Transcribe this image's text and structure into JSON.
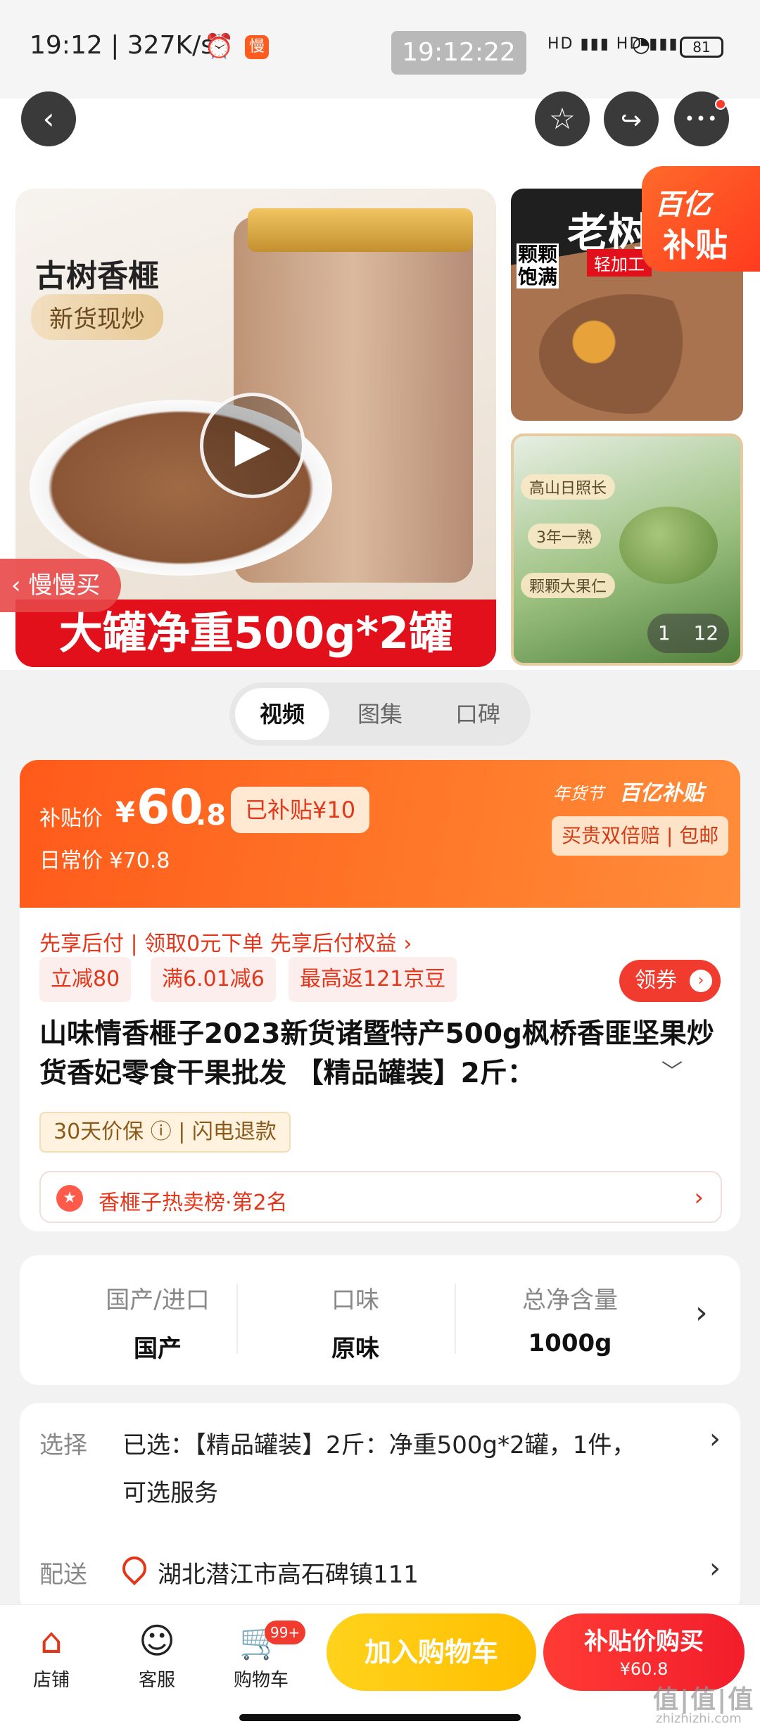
{
  "status_bar": {
    "time": "19:12 | 327K/s",
    "alarm_icon": "alarm-clock-icon",
    "slow_badge": "慢",
    "clock": "19:12:22",
    "signals": "HD ▮▮▮ HD ▮▮▮",
    "battery": "81"
  },
  "nav": {
    "back": "‹",
    "fav": "☆",
    "share": "↪",
    "more": "•••"
  },
  "hero": {
    "brand": "古树香榧",
    "badge": "新货现炒",
    "banner": "大罐净重500g*2罐",
    "slow_buy": "慢慢买",
    "promo_line1": "百亿",
    "promo_line2": "补贴",
    "thumb1_title": "老树",
    "thumb1_side": "颗颗饱满",
    "thumb1_tag": "轻加工",
    "thumb2_labels": [
      "高山日照长",
      "3年一熟",
      "颗颗大果仁"
    ],
    "page_current": "1",
    "page_total": "12"
  },
  "media_tabs": [
    {
      "label": "视频",
      "active": true
    },
    {
      "label": "图集",
      "active": false
    },
    {
      "label": "口碑",
      "active": false
    }
  ],
  "price": {
    "label": "补贴价",
    "currency": "¥",
    "integer": "60",
    "decimal": ".8",
    "subsidy": "已补贴¥10",
    "daily": "日常价 ¥70.8",
    "festival": "年货节",
    "bt_logo": "百亿补贴",
    "guarantee": "买贵双倍赔 | 包邮"
  },
  "benefits": {
    "pay_later": "先享后付 | 领取0元下单 先享后付权益 ›",
    "chips": [
      "立减80",
      "满6.01减6",
      "最高返121京豆"
    ],
    "coupon": "领券"
  },
  "product": {
    "title": "山味情香榧子2023新货诸暨特产500g枫桥香匪坚果炒货香妃零食干果批发 【精品罐装】2斤：",
    "guard_tag": "30天价保 ⓘ | 闪电退款",
    "rank": "香榧子热卖榜·第2名"
  },
  "attributes": [
    {
      "key": "国产/进口",
      "value": "国产"
    },
    {
      "key": "口味",
      "value": "原味"
    },
    {
      "key": "总净含量",
      "value": "1000g"
    }
  ],
  "selection": {
    "select_key": "选择",
    "select_value_line1": "已选：【精品罐装】2斤：净重500g*2罐，1件，",
    "select_value_line2": "可选服务",
    "delivery_key": "配送",
    "delivery_value": "湖北潜江市高石碑镇111"
  },
  "bottom_bar": {
    "store": "店铺",
    "service": "客服",
    "cart": "购物车",
    "cart_badge": "99+",
    "add_cart": "加入购物车",
    "buy_line1": "补贴价购买",
    "buy_line2": "¥60.8"
  },
  "watermark": {
    "main": "值|值|值",
    "sub": "zhizhizhi.com"
  },
  "colors": {
    "accent": "#ff5a1a",
    "red": "#f23b2f",
    "yellow": "#ffc20e"
  }
}
